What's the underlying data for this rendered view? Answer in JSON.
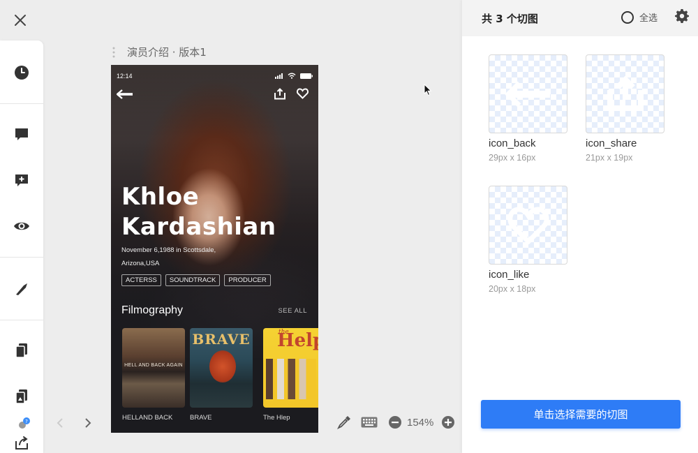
{
  "artboard": {
    "title": "演员介绍 · 版本1",
    "status_time": "12:14",
    "actor_first_name": "Khloe",
    "actor_last_name": "Kardashian",
    "birth_line1": "November 6,1988 in Scottsdale,",
    "birth_line2": "Arizona,USA",
    "tags": [
      "ACTERSS",
      "SOUNDTRACK",
      "PRODUCER"
    ],
    "section_title": "Filmography",
    "see_all": "SEE ALL",
    "films": [
      {
        "label": "HELLAND BACK",
        "poster_text": "HELL AND BACK AGAIN"
      },
      {
        "label": "BRAVE",
        "poster_text": "BRAVE"
      },
      {
        "label": "The Hlep",
        "poster_text_small": "the",
        "poster_text": "Help"
      }
    ]
  },
  "canvas": {
    "zoom": "154%"
  },
  "right_panel": {
    "count_label": "共 3 个切图",
    "select_all": "全选",
    "slices": [
      {
        "name": "icon_back",
        "size": "29px x 16px"
      },
      {
        "name": "icon_share",
        "size": "21px x 19px"
      },
      {
        "name": "icon_like",
        "size": "20px x 18px"
      }
    ],
    "primary_button": "单击选择需要的切图"
  },
  "colors": {
    "accent": "#2e7cf6",
    "canvas_bg": "#ededed",
    "artboard_bg": "#1b1b1f"
  },
  "icons": {
    "left_toolbar": [
      "clock-icon",
      "comment-icon",
      "add-comment-icon",
      "eye-icon",
      "slice-knife-icon",
      "copy-icon",
      "assets-icon",
      "share-export-icon"
    ],
    "canvas_bar": [
      "prev-arrow-icon",
      "next-arrow-icon",
      "eyedropper-icon",
      "keyboard-icon",
      "zoom-out-icon",
      "zoom-in-icon"
    ]
  }
}
